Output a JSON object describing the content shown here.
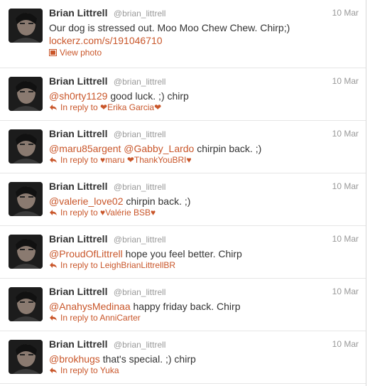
{
  "tweets": [
    {
      "name": "Brian Littrell",
      "handle": "@brian_littrell",
      "time": "10 Mar",
      "text": "Our dog is stressed out. Moo Moo Chew Chew. Chirp;)",
      "link": "lockerz.com/s/191046710",
      "action": "View photo"
    },
    {
      "name": "Brian Littrell",
      "handle": "@brian_littrell",
      "time": "10 Mar",
      "mention": "@sh0rty1129",
      "text": " good luck. ;) chirp",
      "reply": "In reply to ",
      "reply_to": "❤Erika Garcia❤"
    },
    {
      "name": "Brian Littrell",
      "handle": "@brian_littrell",
      "time": "10 Mar",
      "mention": "@maru85argent",
      "mention2": "@Gabby_Lardo",
      "text": " chirpin back. ;)",
      "reply": "In reply to ",
      "reply_to": "♥maru ❤ThankYouBRI♥"
    },
    {
      "name": "Brian Littrell",
      "handle": "@brian_littrell",
      "time": "10 Mar",
      "mention": "@valerie_love02",
      "text": " chirpin back. ;)",
      "reply": "In reply to ",
      "reply_to": "♥Valérie BSB♥"
    },
    {
      "name": "Brian Littrell",
      "handle": "@brian_littrell",
      "time": "10 Mar",
      "mention": "@ProudOfLittrell",
      "text": " hope you feel better. Chirp",
      "reply": "In reply to ",
      "reply_to": "LeighBrianLittrellBR"
    },
    {
      "name": "Brian Littrell",
      "handle": "@brian_littrell",
      "time": "10 Mar",
      "mention": "@AnahysMedinaa",
      "text": " happy friday back. Chirp",
      "reply": "In reply to ",
      "reply_to": "AnniCarter"
    },
    {
      "name": "Brian Littrell",
      "handle": "@brian_littrell",
      "time": "10 Mar",
      "mention": "@brokhugs",
      "text": " that's special. ;) chirp",
      "reply": "In reply to ",
      "reply_to": "Yuka"
    }
  ],
  "colors": {
    "link": "#c9562a",
    "name": "#333333",
    "muted": "#999999",
    "divider": "#e6e6e6"
  },
  "icons": {
    "avatar": "avatar-photo",
    "reply": "reply-arrow-icon",
    "photo": "photo-icon"
  }
}
